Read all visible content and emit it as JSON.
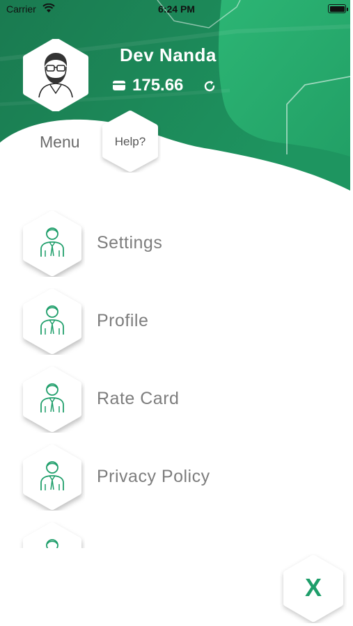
{
  "status_bar": {
    "carrier": "Carrier",
    "time": "6:24 PM"
  },
  "profile": {
    "name": "Dev Nanda",
    "balance": "175.66"
  },
  "header": {
    "menu_label": "Menu",
    "help_label": "Help?"
  },
  "menu": {
    "items": [
      {
        "label": "Settings",
        "icon": "person-icon"
      },
      {
        "label": "Profile",
        "icon": "person-icon"
      },
      {
        "label": "Rate Card",
        "icon": "person-icon"
      },
      {
        "label": "Privacy Policy",
        "icon": "person-icon"
      },
      {
        "label": "",
        "icon": "person-icon"
      }
    ]
  },
  "close": {
    "label": "X"
  },
  "colors": {
    "header_dark": "#157a4e",
    "header_light": "#29a86c",
    "accent": "#1e9e6a",
    "label_gray": "#7d7d7d"
  }
}
